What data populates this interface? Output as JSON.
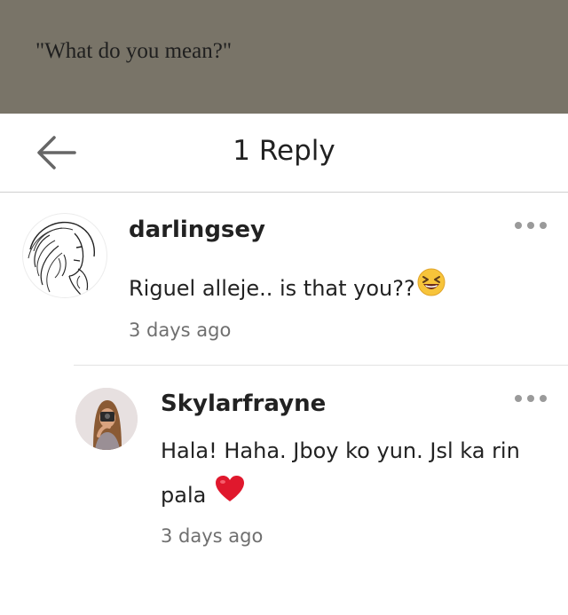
{
  "story_excerpt": {
    "text": "\"What do you mean?\""
  },
  "header": {
    "title": "1 Reply",
    "back_icon": "arrow-left-icon"
  },
  "parent_comment": {
    "username": "darlingsey",
    "text": "Riguel alleje.. is that you??",
    "emoji": "grinning-squinting-face-emoji",
    "timestamp": "3 days ago",
    "more_icon": "more-horizontal-icon"
  },
  "reply": {
    "username": "Skylarfrayne",
    "text_line1": "Hala! Haha. Jboy ko yun. Jsl ka rin",
    "text_line2": "pala",
    "emoji": "red-heart-emoji",
    "timestamp": "3 days ago",
    "more_icon": "more-horizontal-icon"
  },
  "colors": {
    "quote_bar_bg": "#797468",
    "text": "#222222",
    "muted": "#6f6f6f",
    "divider": "#e3e3e3",
    "heart": "#e0182d",
    "emoji_face": "#f7c43a"
  }
}
